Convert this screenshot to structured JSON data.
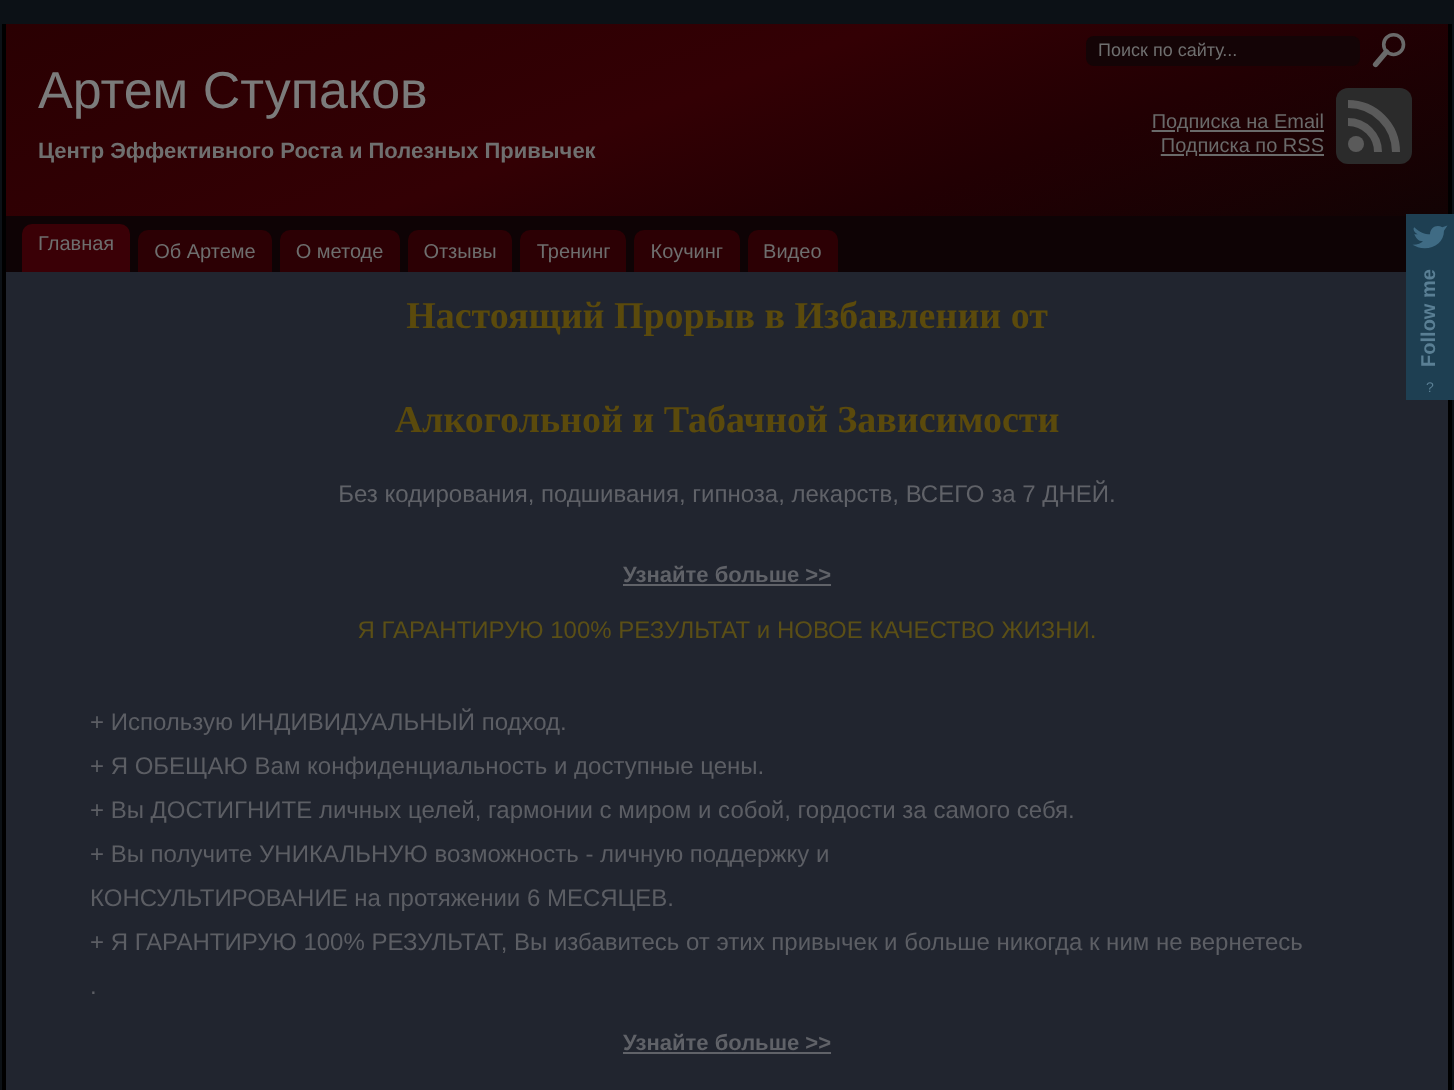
{
  "header": {
    "title": "Артем Ступаков",
    "tagline": "Центр Эффективного Роста и Полезных Привычек",
    "search": {
      "placeholder": "Поиск по сайту..."
    },
    "subscribe_links": [
      "Подписка на Email",
      "Подписка по RSS"
    ]
  },
  "nav": {
    "tabs": [
      {
        "label": "Главная",
        "selected": true
      },
      {
        "label": "Об Артеме",
        "selected": false
      },
      {
        "label": "О методе",
        "selected": false
      },
      {
        "label": "Отзывы",
        "selected": false
      },
      {
        "label": "Тренинг",
        "selected": false
      },
      {
        "label": "Коучинг",
        "selected": false
      },
      {
        "label": "Видео",
        "selected": false
      }
    ]
  },
  "content": {
    "headings": [
      "Настоящий Прорыв в Избавлении от",
      "Алкогольной и Табачной Зависимости"
    ],
    "intro": "Без кодирования, подшивания, гипноза, лекарств, ВСЕГО за 7 ДНЕЙ.",
    "more_link": "Узнайте больше >>",
    "guarantee": "Я ГАРАНТИРУЮ 100% РЕЗУЛЬТАТ и НОВОЕ КАЧЕСТВО ЖИЗНИ.",
    "benefits": [
      "+ Использую ИНДИВИДУАЛЬНЫЙ подход.",
      "+ Я ОБЕЩАЮ Вам конфиденциальность и доступные цены.",
      "+ Вы ДОСТИГНИТЕ личных целей, гармонии с миром и собой, гордости за самого себя.",
      "+ Вы получите УНИКАЛЬНУЮ возможность - личную поддержку и",
      "КОНСУЛЬТИРОВАНИЕ на протяжении 6 МЕСЯЦЕВ.",
      "+ Я ГАРАНТИРУЮ 100% РЕЗУЛЬТАТ, Вы избавитесь от этих привычек и больше никогда к ним не вернетесь",
      "."
    ],
    "more_link_bottom": "Узнайте больше >>"
  },
  "follow_tab": {
    "label": "Follow me",
    "help": "?"
  }
}
